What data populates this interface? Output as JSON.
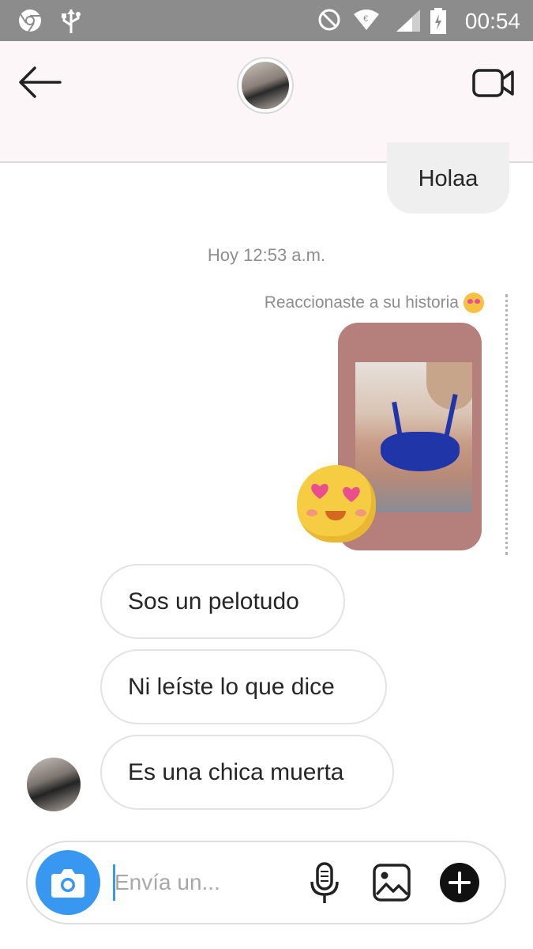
{
  "status_bar": {
    "time": "00:54",
    "icons": [
      "chrome-icon",
      "usb-icon",
      "do-not-disturb-icon",
      "wifi-icon",
      "signal-icon",
      "battery-icon"
    ]
  },
  "header": {
    "back_icon": "arrow-left-icon",
    "video_icon": "video-camera-icon"
  },
  "messages": {
    "outgoing_top": "Holaa",
    "timestamp": "Hoy 12:53 a.m.",
    "story_reaction_note": "Reaccionaste a su historia",
    "incoming": [
      "Sos un pelotudo",
      "Ni leíste lo que dice",
      "Es una chica muerta"
    ]
  },
  "composer": {
    "placeholder": "Envía un...",
    "camera_icon": "camera-icon",
    "mic_icon": "microphone-icon",
    "gallery_icon": "image-gallery-icon",
    "plus_icon": "plus-circle-icon"
  },
  "colors": {
    "status_bar": "#8c8c8c",
    "accent_blue": "#3897f0",
    "story_card": "#b57f7b",
    "emoji_yellow": "#f6cd42"
  }
}
